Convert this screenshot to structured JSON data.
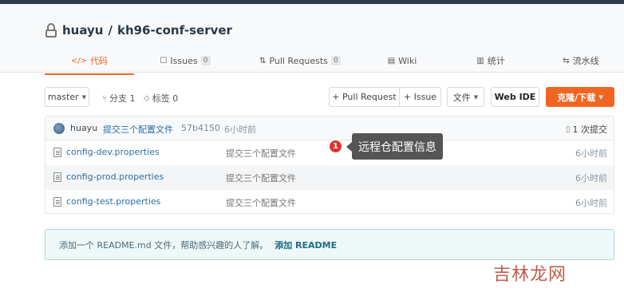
{
  "repo": {
    "owner": "huayu",
    "separator": "/",
    "name": "kh96-conf-server"
  },
  "tabs": [
    {
      "icon": "</>",
      "label": "代码"
    },
    {
      "icon": "☐",
      "label": "Issues",
      "count": "0"
    },
    {
      "icon": "⇅",
      "label": "Pull Requests",
      "count": "0"
    },
    {
      "icon": "▤",
      "label": "Wiki"
    },
    {
      "icon": "▥",
      "label": "统计"
    },
    {
      "icon": "⇆",
      "label": "流水线"
    }
  ],
  "toolbar": {
    "branch": "master",
    "branches": "分支 1",
    "tags": "标签 0",
    "pull_request": "+ Pull Request",
    "issue": "+ Issue",
    "file": "文件",
    "web_ide": "Web IDE",
    "clone": "克隆/下载"
  },
  "commit": {
    "author": "huayu",
    "message": "提交三个配置文件",
    "hash": "57b4150",
    "time": "6小时前",
    "total": "1 次提交"
  },
  "files": [
    {
      "name": "config-dev.properties",
      "message": "提交三个配置文件",
      "time": "6小时前"
    },
    {
      "name": "config-prod.properties",
      "message": "提交三个配置文件",
      "time": "6小时前"
    },
    {
      "name": "config-test.properties",
      "message": "提交三个配置文件",
      "time": "6小时前"
    }
  ],
  "tooltip": {
    "badge": "1",
    "text": "远程仓配置信息"
  },
  "readme": {
    "text": "添加一个 README.md 文件，帮助感兴趣的人了解。",
    "link": "添加 README"
  },
  "watermark": "吉林龙网",
  "colors": {
    "accent": "#f06522",
    "link": "#2d6fa8",
    "tooltip_badge": "#e0322b"
  }
}
